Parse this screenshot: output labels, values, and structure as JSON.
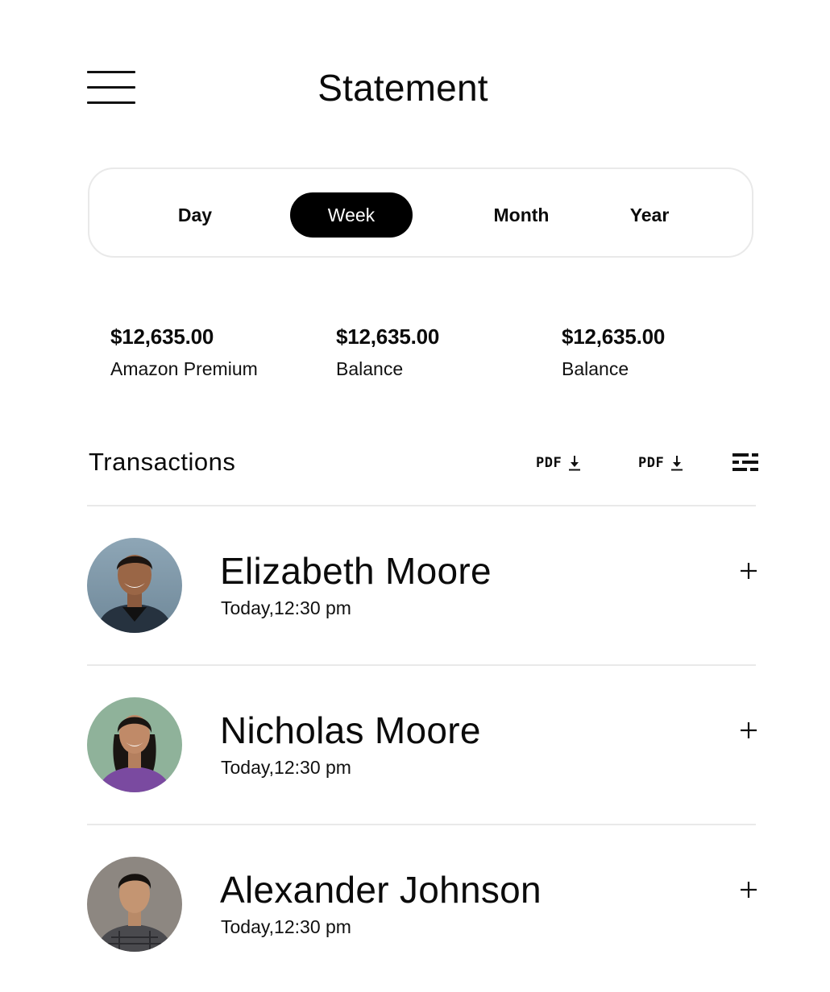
{
  "header": {
    "title": "Statement",
    "menu_icon": "hamburger-menu-icon"
  },
  "period": {
    "tabs": [
      {
        "label": "Day",
        "active": false
      },
      {
        "label": "Week",
        "active": true
      },
      {
        "label": "Month",
        "active": false
      },
      {
        "label": "Year",
        "active": false
      }
    ],
    "selected": "Week"
  },
  "summary": [
    {
      "amount": "$12,635.00",
      "label": "Amazon Premium"
    },
    {
      "amount": "$12,635.00",
      "label": "Balance"
    },
    {
      "amount": "$12,635.00",
      "label": "Balance"
    }
  ],
  "transactions": {
    "title": "Transactions",
    "actions": [
      {
        "label": "PDF",
        "icon": "download-icon"
      },
      {
        "label": "PDF",
        "icon": "download-icon"
      }
    ],
    "filter_icon": "filter-icon",
    "items": [
      {
        "name": "Elizabeth Moore",
        "time": "Today,12:30 pm",
        "action_icon": "plus-icon"
      },
      {
        "name": "Nicholas Moore",
        "time": "Today,12:30 pm",
        "action_icon": "plus-icon"
      },
      {
        "name": "Alexander Johnson",
        "time": "Today,12:30 pm",
        "action_icon": "plus-icon"
      }
    ]
  },
  "colors": {
    "text": "#0b0b0b",
    "active_tab_bg": "#000000",
    "active_tab_text": "#ffffff",
    "border": "#e9e9e9",
    "background": "#ffffff"
  }
}
